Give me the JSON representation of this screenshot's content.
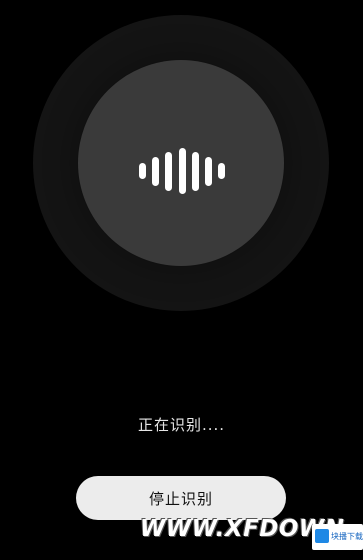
{
  "status": {
    "text": "正在识别...."
  },
  "actions": {
    "stop_label": "停止识别"
  },
  "waveform": {
    "icon": "voice-waveform-icon",
    "bars": [
      0.35,
      0.62,
      0.85,
      1.0,
      0.85,
      0.62,
      0.35
    ]
  },
  "watermark": {
    "text": "WWW.XFDOWN",
    "badge_text": "块播下载网",
    "badge_icon": "logo-icon"
  },
  "colors": {
    "background": "#000000",
    "orb_outer": "#141414",
    "orb_inner": "#3a3a3a",
    "button_bg": "#ececec",
    "text": "#e6e6e6"
  }
}
